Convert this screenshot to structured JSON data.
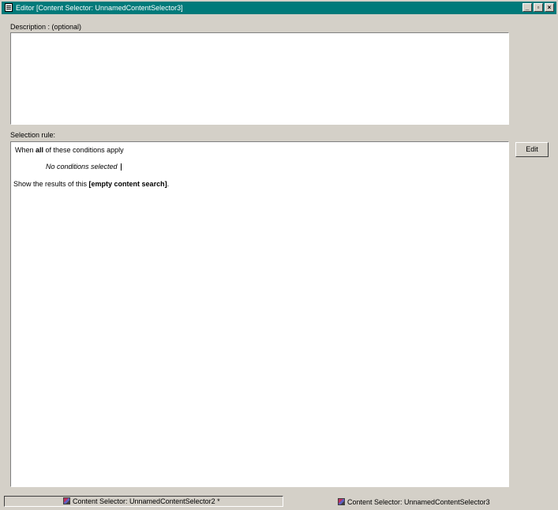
{
  "window": {
    "title": "Editor [Content Selector: UnnamedContentSelector3]"
  },
  "description": {
    "label": "Description : (optional)",
    "value": ""
  },
  "selection_rule": {
    "label": "Selection rule:",
    "line1_prefix": "When ",
    "line1_link": "all",
    "line1_suffix": " of these conditions apply",
    "no_conditions": "No conditions selected",
    "line3_prefix": "Show the results of this ",
    "line3_link": "[empty content search]",
    "line3_suffix": "."
  },
  "buttons": {
    "edit": "Edit"
  },
  "taskbar": {
    "tab1": "Content Selector: UnnamedContentSelector2 *",
    "tab2": "Content Selector: UnnamedContentSelector3"
  }
}
